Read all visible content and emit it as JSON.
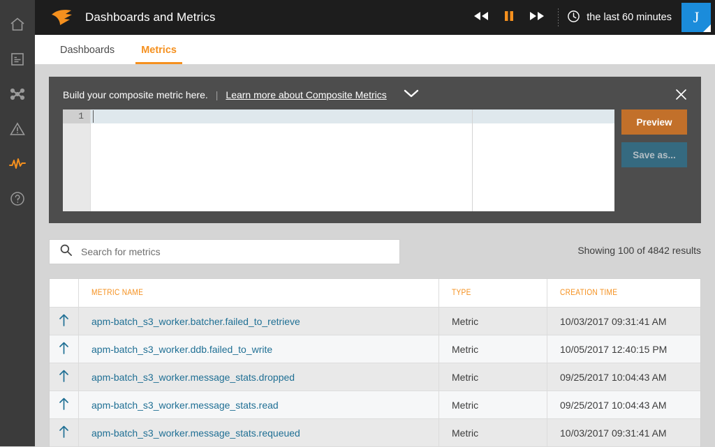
{
  "sidebar": {
    "items": [
      {
        "name": "home",
        "icon": "home-icon",
        "active": false
      },
      {
        "name": "reports",
        "icon": "document-icon",
        "active": false
      },
      {
        "name": "topology",
        "icon": "network-icon",
        "active": false
      },
      {
        "name": "alerts",
        "icon": "warning-triangle-icon",
        "active": false
      },
      {
        "name": "metrics",
        "icon": "pulse-icon",
        "active": true
      },
      {
        "name": "help",
        "icon": "question-circle-icon",
        "active": false
      }
    ]
  },
  "header": {
    "title": "Dashboards and Metrics",
    "logo_icon": "solarwinds-flame-logo",
    "transport": [
      {
        "label": "rewind",
        "icon": "rewind-icon",
        "active": false
      },
      {
        "label": "pause",
        "icon": "pause-icon",
        "active": true
      },
      {
        "label": "fast-forward",
        "icon": "fast-forward-icon",
        "active": false
      }
    ],
    "time_range": "the last 60 minutes",
    "time_range_icon": "clock-icon",
    "avatar_initial": "J"
  },
  "tabs": [
    {
      "label": "Dashboards",
      "active": false
    },
    {
      "label": "Metrics",
      "active": true
    }
  ],
  "composite": {
    "prompt": "Build your composite metric here.",
    "separator": "|",
    "link_text": "Learn more about Composite Metrics",
    "chevron_icon": "chevron-down-icon",
    "close_icon": "close-icon",
    "editor": {
      "line_number": "1",
      "content": ""
    },
    "preview_label": "Preview",
    "save_as_label": "Save as..."
  },
  "search": {
    "placeholder": "Search for metrics",
    "value": "",
    "icon": "search-icon"
  },
  "results_text": "Showing 100 of 4842 results",
  "table": {
    "columns": [
      "",
      "METRIC NAME",
      "TYPE",
      "CREATION TIME"
    ],
    "rows": [
      {
        "icon": "arrow-up-icon",
        "name": "apm-batch_s3_worker.batcher.failed_to_retrieve",
        "type": "Metric",
        "created": "10/03/2017 09:31:41 AM"
      },
      {
        "icon": "arrow-up-icon",
        "name": "apm-batch_s3_worker.ddb.failed_to_write",
        "type": "Metric",
        "created": "10/05/2017 12:40:15 PM"
      },
      {
        "icon": "arrow-up-icon",
        "name": "apm-batch_s3_worker.message_stats.dropped",
        "type": "Metric",
        "created": "09/25/2017 10:04:43 AM"
      },
      {
        "icon": "arrow-up-icon",
        "name": "apm-batch_s3_worker.message_stats.read",
        "type": "Metric",
        "created": "09/25/2017 10:04:43 AM"
      },
      {
        "icon": "arrow-up-icon",
        "name": "apm-batch_s3_worker.message_stats.requeued",
        "type": "Metric",
        "created": "10/03/2017 09:31:41 AM"
      }
    ]
  },
  "colors": {
    "accent_orange": "#f5901e",
    "link_blue": "#1f6f94",
    "panel_dark": "#4d4d4d",
    "topbar_dark": "#1d1d1d",
    "rail_dark": "#3b3b3b",
    "preview_button": "#c2702a",
    "save_button": "#356a80",
    "avatar_blue": "#1b8cdb"
  }
}
